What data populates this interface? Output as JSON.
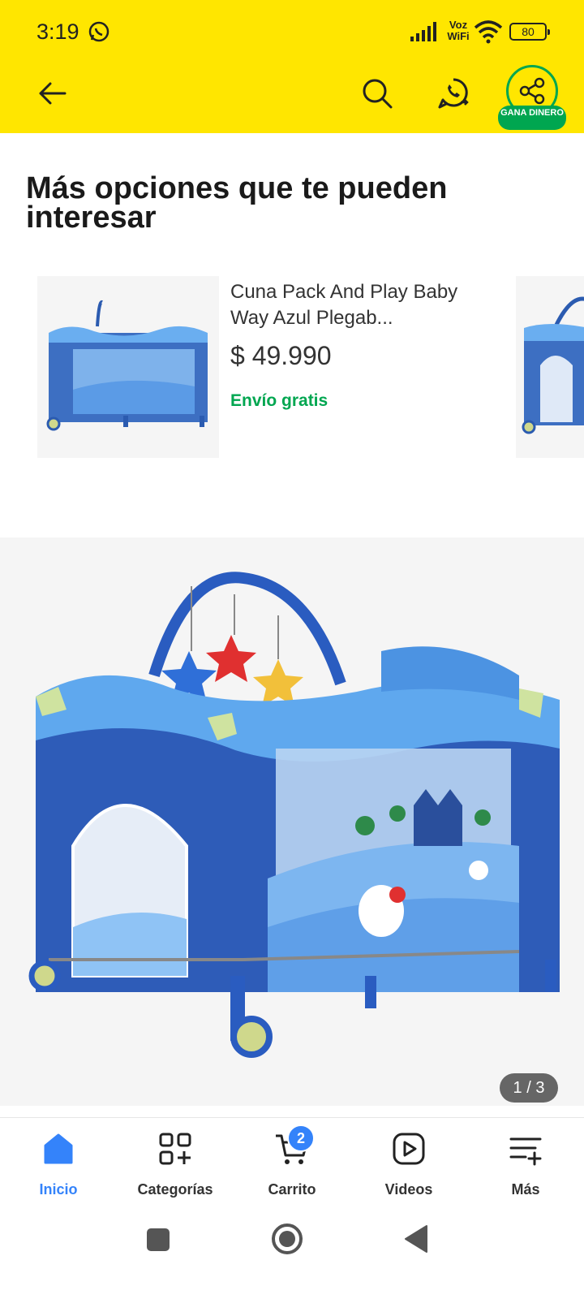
{
  "status_bar": {
    "time": "3:19",
    "network_label": "Voz WiFi",
    "battery": "80"
  },
  "header": {
    "share_badge": "GANA DINERO"
  },
  "recommendations": {
    "title": "Más opciones que te pueden interesar",
    "items": [
      {
        "title": "Cuna Pack And Play Baby Way Azul Plegab...",
        "price": "$ 49.990",
        "shipping": "Envío gratis"
      }
    ]
  },
  "gallery": {
    "counter": "1 / 3"
  },
  "bottom_nav": {
    "tabs": [
      {
        "label": "Inicio",
        "icon": "home-icon",
        "active": true
      },
      {
        "label": "Categorías",
        "icon": "categories-icon"
      },
      {
        "label": "Carrito",
        "icon": "cart-icon",
        "badge": "2"
      },
      {
        "label": "Videos",
        "icon": "play-icon"
      },
      {
        "label": "Más",
        "icon": "menu-plus-icon"
      }
    ]
  },
  "colors": {
    "brand_yellow": "#ffe600",
    "accent_blue": "#3483fa",
    "success_green": "#00a650"
  }
}
